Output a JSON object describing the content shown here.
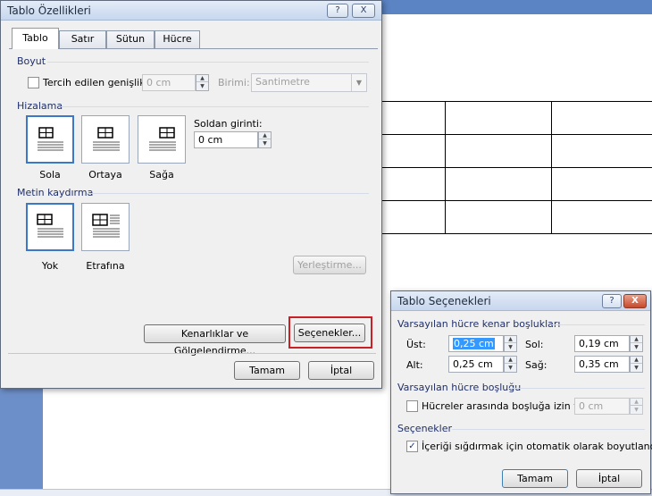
{
  "main_dialog": {
    "title": "Tablo Özellikleri",
    "help_label": "?",
    "close_label": "X",
    "tabs": [
      "Tablo",
      "Satır",
      "Sütun",
      "Hücre"
    ],
    "sections": {
      "size": "Boyut",
      "alignment": "Hizalama",
      "wrap": "Metin kaydırma"
    },
    "preferred_width_label": "Tercih edilen genişlik:",
    "preferred_width_value": "0 cm",
    "unit_label": "Birimi:",
    "unit_value": "Santimetre",
    "indent_label": "Soldan girinti:",
    "indent_value": "0 cm",
    "align_options": [
      "Sola",
      "Ortaya",
      "Sağa"
    ],
    "wrap_options": [
      "Yok",
      "Etrafına"
    ],
    "positioning_button": "Yerleştirme...",
    "borders_button": "Kenarlıklar ve Gölgelendirme...",
    "options_button": "Seçenekler...",
    "ok_button": "Tamam",
    "cancel_button": "İptal"
  },
  "options_dialog": {
    "title": "Tablo Seçenekleri",
    "help_label": "?",
    "close_label": "X",
    "margins_section": "Varsayılan hücre kenar boşlukları",
    "top_label": "Üst:",
    "top_value": "0,25 cm",
    "left_label": "Sol:",
    "left_value": "0,19 cm",
    "bottom_label": "Alt:",
    "bottom_value": "0,25 cm",
    "right_label": "Sağ:",
    "right_value": "0,35 cm",
    "spacing_section": "Varsayılan hücre boşluğu",
    "allow_spacing_label": "Hücreler arasında boşluğa izin ver",
    "spacing_value": "0 cm",
    "options_section": "Seçenekler",
    "autofit_label": "İçeriği sığdırmak için otomatik olarak boyutlandır",
    "ok_button": "Tamam",
    "cancel_button": "İptal"
  },
  "colors": {
    "selection_highlight": "#3399ff",
    "callout": "#c82026"
  }
}
